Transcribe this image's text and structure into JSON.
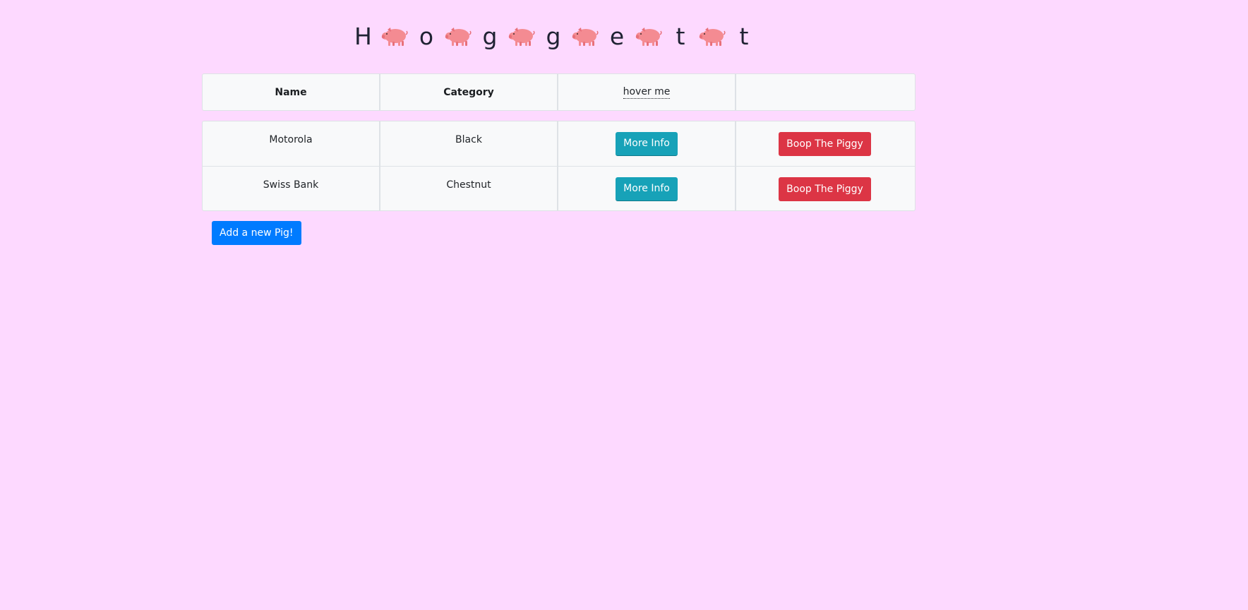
{
  "title": {
    "letters": [
      "H",
      "o",
      "g",
      "g",
      "e",
      "t",
      "t"
    ],
    "separator_icon": "pig-icon"
  },
  "table": {
    "headers": [
      "Name",
      "Category",
      "hover me",
      ""
    ],
    "rows": [
      {
        "name": "Motorola",
        "category": "Black",
        "info_label": "More Info",
        "boop_label": "Boop The Piggy"
      },
      {
        "name": "Swiss Bank",
        "category": "Chestnut",
        "info_label": "More Info",
        "boop_label": "Boop The Piggy"
      }
    ]
  },
  "add_button_label": "Add a new Pig!",
  "colors": {
    "background": "#fdd9ff",
    "info": "#17a2b8",
    "danger": "#dc3545",
    "primary": "#007bff",
    "pig": "#f48b92"
  }
}
